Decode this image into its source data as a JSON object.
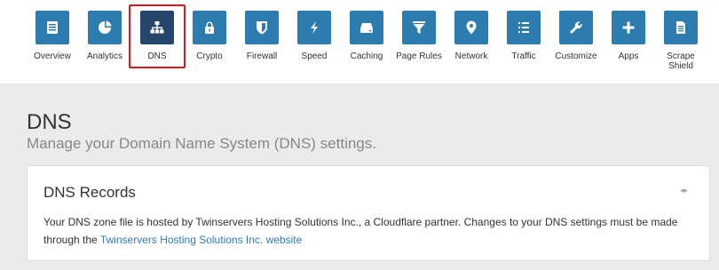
{
  "nav": {
    "items": [
      {
        "label": "Overview",
        "icon": "overview-icon"
      },
      {
        "label": "Analytics",
        "icon": "analytics-icon"
      },
      {
        "label": "DNS",
        "icon": "dns-icon",
        "active": true
      },
      {
        "label": "Crypto",
        "icon": "lock-icon"
      },
      {
        "label": "Firewall",
        "icon": "shield-icon"
      },
      {
        "label": "Speed",
        "icon": "lightning-icon"
      },
      {
        "label": "Caching",
        "icon": "hard-drive-icon"
      },
      {
        "label": "Page Rules",
        "icon": "filter-icon"
      },
      {
        "label": "Network",
        "icon": "location-pin-icon"
      },
      {
        "label": "Traffic",
        "icon": "list-icon"
      },
      {
        "label": "Customize",
        "icon": "wrench-icon"
      },
      {
        "label": "Apps",
        "icon": "plus-icon"
      },
      {
        "label": "Scrape\nShield",
        "icon": "document-icon"
      }
    ]
  },
  "page": {
    "title": "DNS",
    "subtitle": "Manage your Domain Name System (DNS) settings."
  },
  "card": {
    "title": "DNS Records",
    "toggle": "◂▸",
    "text": "Your DNS zone file is hosted by Twinservers Hosting Solutions Inc., a Cloudflare partner. Changes to your DNS settings must be made through the ",
    "link_text": "Twinservers Hosting Solutions Inc. website"
  },
  "colors": {
    "tile": "#2c7cb0",
    "tile_active": "#24466c",
    "highlight": "#e0161c",
    "link": "#2f7bbf"
  }
}
